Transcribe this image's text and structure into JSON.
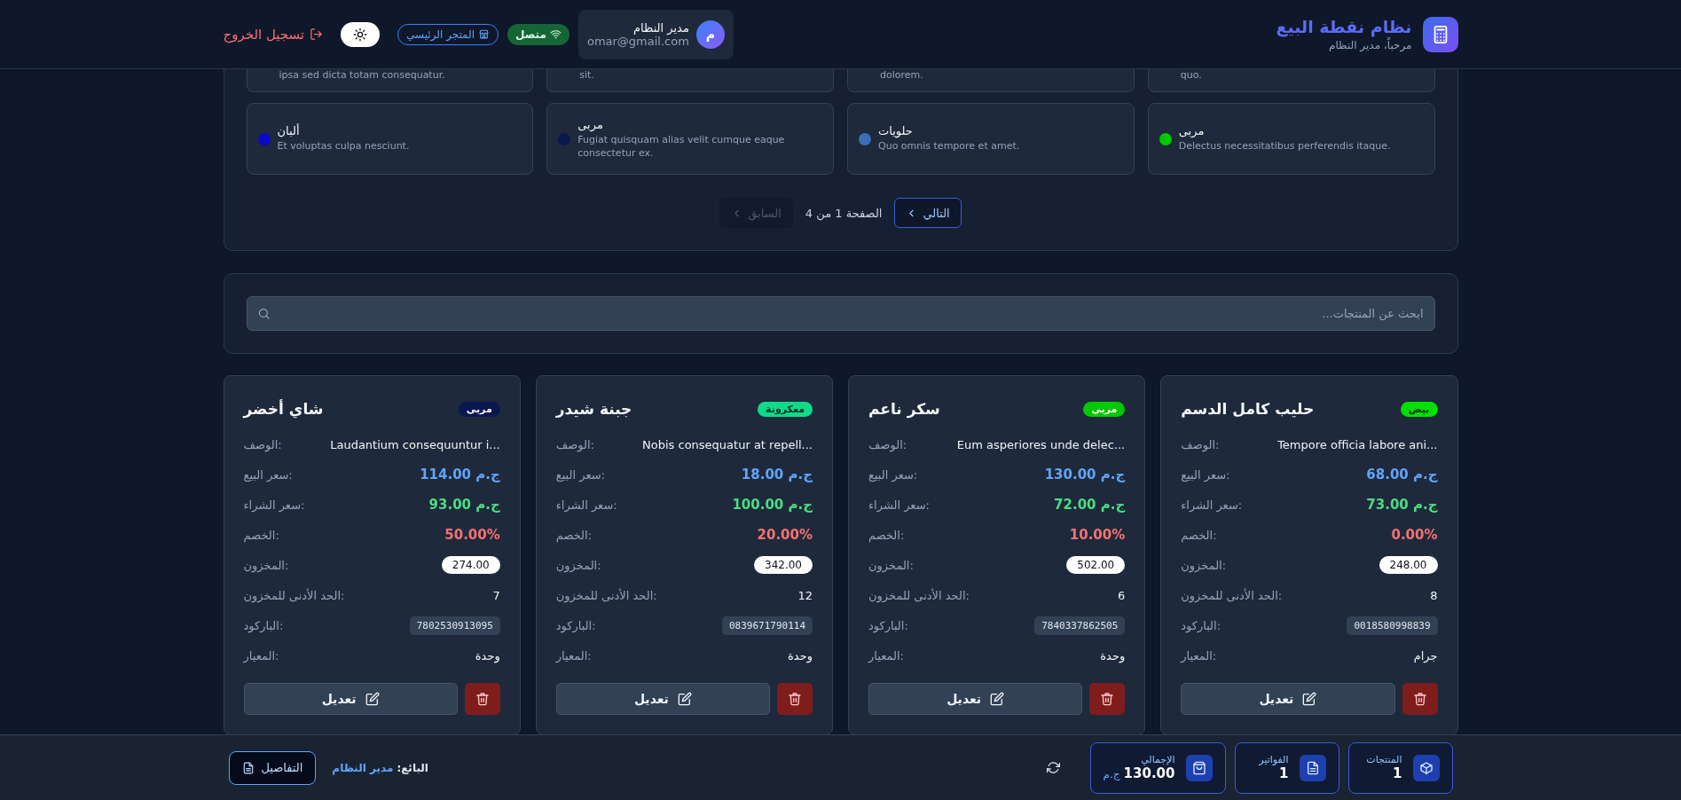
{
  "header": {
    "title": "نظام نقطة البيع",
    "subtitle": "مرحباً، مدير النظام",
    "user": {
      "avatar": "م",
      "name": "مدير النظام",
      "email": "omar@gmail.com"
    },
    "status": "متصل",
    "dark_mode": true,
    "store": "المتجر الرئيسي",
    "logout": "تسجيل الخروج"
  },
  "categories": {
    "partial": [
      {
        "description": "quo."
      },
      {
        "description": "dolorem."
      },
      {
        "description": "sit."
      },
      {
        "description": "ipsa sed dicta totam consequatur."
      }
    ],
    "items": [
      {
        "name": "مربى",
        "description": "Delectus necessitatibus perferendis itaque.",
        "color": "#00c800"
      },
      {
        "name": "حلويات",
        "description": "Quo omnis tempore et amet.",
        "color": "#3a6fb8"
      },
      {
        "name": "مربى",
        "description": "Fugiat quisquam alias velit cumque eaque consectetur ex.",
        "color": "#0a1850"
      },
      {
        "name": "ألبان",
        "description": "Et voluptas culpa nesciunt.",
        "color": "#0a0ac8"
      }
    ],
    "pagination": {
      "next": {
        "label": "التالي",
        "disabled": false
      },
      "page_info": "الصفحة 1 من 4",
      "previous": {
        "label": "السابق",
        "disabled": true
      }
    }
  },
  "search": {
    "placeholder": "ابحث عن المنتجات..."
  },
  "products": [
    {
      "name": "حليب كامل الدسم",
      "tag": {
        "label": "بيض",
        "color": "#00e000"
      },
      "fields": [
        {
          "kind": "text",
          "label": "الوصف:",
          "value": "Tempore officia labore ani..."
        },
        {
          "kind": "sell",
          "label": "سعر البيع:",
          "value": "68.00 ج.م"
        },
        {
          "kind": "buy",
          "label": "سعر الشراء:",
          "value": "73.00 ج.م"
        },
        {
          "kind": "discount",
          "label": "الخصم:",
          "value": "0.00%"
        },
        {
          "kind": "stock",
          "label": "المخزون:",
          "value": "248.00"
        },
        {
          "kind": "plain",
          "label": "الحد الأدنى للمخزون:",
          "value": "8"
        },
        {
          "kind": "barcode",
          "label": "الباركود:",
          "value": "0018580998839"
        },
        {
          "kind": "plain",
          "label": "المعيار:",
          "value": "جرام"
        }
      ],
      "edit": "تعديل"
    },
    {
      "name": "سكر ناعم",
      "tag": {
        "label": "مربى",
        "color": "#00c800"
      },
      "fields": [
        {
          "kind": "text",
          "label": "الوصف:",
          "value": "Eum asperiores unde delec..."
        },
        {
          "kind": "sell",
          "label": "سعر البيع:",
          "value": "130.00 ج.م"
        },
        {
          "kind": "buy",
          "label": "سعر الشراء:",
          "value": "72.00 ج.م"
        },
        {
          "kind": "discount",
          "label": "الخصم:",
          "value": "10.00%"
        },
        {
          "kind": "stock",
          "label": "المخزون:",
          "value": "502.00"
        },
        {
          "kind": "plain",
          "label": "الحد الأدنى للمخزون:",
          "value": "6"
        },
        {
          "kind": "barcode",
          "label": "الباركود:",
          "value": "7840337862505"
        },
        {
          "kind": "plain",
          "label": "المعيار:",
          "value": "وحدة"
        }
      ],
      "edit": "تعديل"
    },
    {
      "name": "جبنة شيدر",
      "tag": {
        "label": "معكرونة",
        "color": "#10d98a"
      },
      "fields": [
        {
          "kind": "text",
          "label": "الوصف:",
          "value": "Nobis consequatur at repell..."
        },
        {
          "kind": "sell",
          "label": "سعر البيع:",
          "value": "18.00 ج.م"
        },
        {
          "kind": "buy",
          "label": "سعر الشراء:",
          "value": "100.00 ج.م"
        },
        {
          "kind": "discount",
          "label": "الخصم:",
          "value": "20.00%"
        },
        {
          "kind": "stock",
          "label": "المخزون:",
          "value": "342.00"
        },
        {
          "kind": "plain",
          "label": "الحد الأدنى للمخزون:",
          "value": "12"
        },
        {
          "kind": "barcode",
          "label": "الباركود:",
          "value": "0839671790114"
        },
        {
          "kind": "plain",
          "label": "المعيار:",
          "value": "وحدة"
        }
      ],
      "edit": "تعديل"
    },
    {
      "name": "شاي أخضر",
      "tag": {
        "label": "مربى",
        "color": "#0a1850"
      },
      "fields": [
        {
          "kind": "text",
          "label": "الوصف:",
          "value": "Laudantium consequuntur i..."
        },
        {
          "kind": "sell",
          "label": "سعر البيع:",
          "value": "114.00 ج.م"
        },
        {
          "kind": "buy",
          "label": "سعر الشراء:",
          "value": "93.00 ج.م"
        },
        {
          "kind": "discount",
          "label": "الخصم:",
          "value": "50.00%"
        },
        {
          "kind": "stock",
          "label": "المخزون:",
          "value": "274.00"
        },
        {
          "kind": "plain",
          "label": "الحد الأدنى للمخزون:",
          "value": "7"
        },
        {
          "kind": "barcode",
          "label": "الباركود:",
          "value": "7802530913095"
        },
        {
          "kind": "plain",
          "label": "المعيار:",
          "value": "وحدة"
        }
      ],
      "edit": "تعديل"
    }
  ],
  "footer": {
    "stats": [
      {
        "label": "المنتجات",
        "value": "1"
      },
      {
        "label": "الفواتير",
        "value": "1"
      },
      {
        "label": "الإجمالي",
        "value": "130.00",
        "unit": "ج.م"
      }
    ],
    "seller_label": "البائع:",
    "seller": "مدير النظام",
    "details": "التفاصيل"
  }
}
